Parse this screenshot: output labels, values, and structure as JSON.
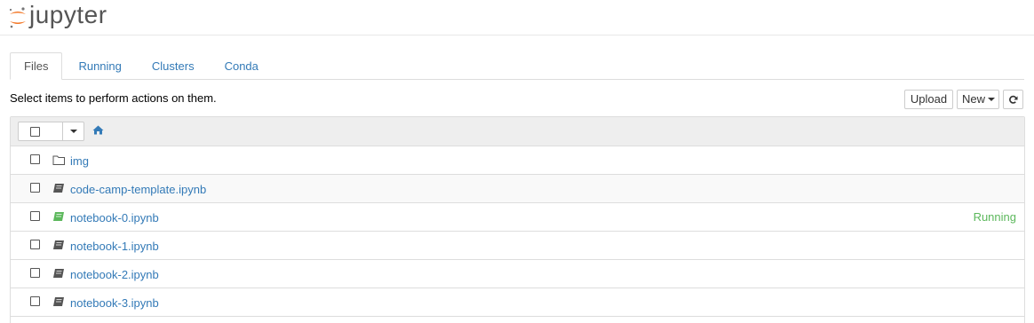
{
  "header": {
    "logo_text": "jupyter",
    "logo_color": "#F37726"
  },
  "tabs": [
    {
      "label": "Files",
      "active": true
    },
    {
      "label": "Running",
      "active": false
    },
    {
      "label": "Clusters",
      "active": false
    },
    {
      "label": "Conda",
      "active": false
    }
  ],
  "toolbar": {
    "instructions": "Select items to perform actions on them.",
    "upload_label": "Upload",
    "new_label": "New",
    "refresh_icon": "refresh-icon"
  },
  "list": {
    "home_icon": "home-icon",
    "items": [
      {
        "name": "img",
        "type": "folder",
        "status": ""
      },
      {
        "name": "code-camp-template.ipynb",
        "type": "notebook",
        "status": ""
      },
      {
        "name": "notebook-0.ipynb",
        "type": "notebook-running",
        "status": "Running"
      },
      {
        "name": "notebook-1.ipynb",
        "type": "notebook",
        "status": ""
      },
      {
        "name": "notebook-2.ipynb",
        "type": "notebook",
        "status": ""
      },
      {
        "name": "notebook-3.ipynb",
        "type": "notebook",
        "status": ""
      }
    ]
  },
  "colors": {
    "link": "#337ab7",
    "running": "#5cb85c",
    "notebook_icon": "#555555",
    "notebook_running_icon": "#5cb85c"
  }
}
